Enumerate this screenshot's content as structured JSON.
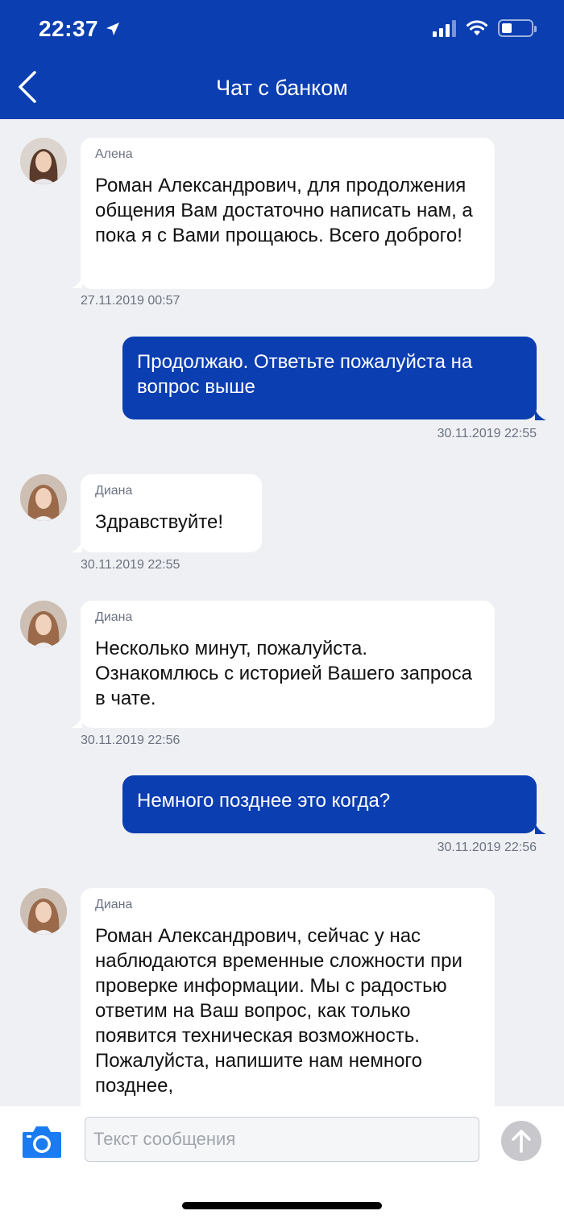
{
  "status_bar": {
    "time": "22:37"
  },
  "header": {
    "title": "Чат с банком"
  },
  "messages": [
    {
      "sender": "Алена",
      "text": "Роман Александрович, для продолжения общения Вам достаточно написать нам, а пока я с Вами прощаюсь. Всего доброго!",
      "time": "27.11.2019 00:57"
    },
    {
      "text": "Продолжаю. Ответьте пожалуйста на вопрос выше",
      "time": "30.11.2019 22:55"
    },
    {
      "sender": "Диана",
      "text": "Здравствуйте!",
      "time": "30.11.2019 22:55"
    },
    {
      "sender": "Диана",
      "text": "Несколько минут, пожалуйста. Ознакомлюсь с историей Вашего запроса в чате.",
      "time": "30.11.2019 22:56"
    },
    {
      "text": "Немного позднее это когда?",
      "time": "30.11.2019 22:56"
    },
    {
      "sender": "Диана",
      "text": "Роман Александрович, сейчас у нас наблюдаются временные сложности при проверке информации. Мы с радостью ответим на Ваш вопрос, как только появится техническая возможность. Пожалуйста, напишите нам немного позднее,"
    }
  ],
  "composer": {
    "placeholder": "Текст сообщения"
  },
  "colors": {
    "brand": "#0a3eb1",
    "background": "#eff0f4"
  }
}
